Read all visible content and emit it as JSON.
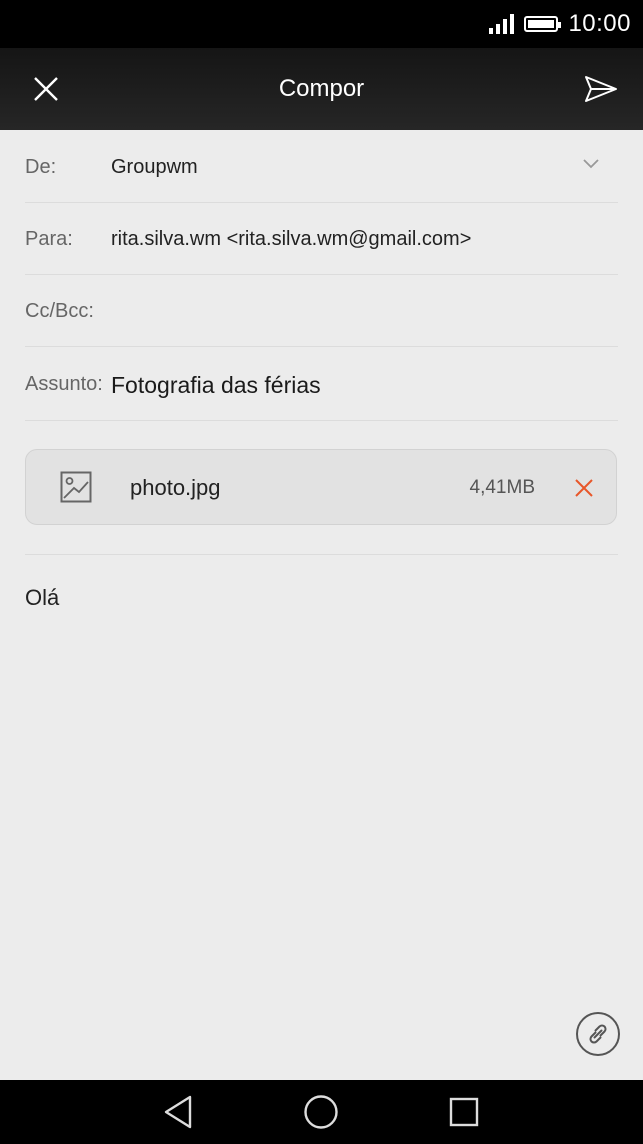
{
  "status_bar": {
    "time": "10:00",
    "signal_icon": "signal-icon",
    "battery_icon": "battery-icon"
  },
  "toolbar": {
    "title": "Compor",
    "close_icon": "close-icon",
    "send_icon": "send-icon"
  },
  "fields": {
    "from": {
      "label": "De:",
      "value": "Groupwm"
    },
    "to": {
      "label": "Para:",
      "value": "rita.silva.wm <rita.silva.wm@gmail.com>"
    },
    "cc_bcc": {
      "label": "Cc/Bcc:",
      "value": ""
    },
    "subject": {
      "label": "Assunto:",
      "value": "Fotografia das férias"
    }
  },
  "attachment": {
    "name": "photo.jpg",
    "size": "4,41MB",
    "remove_color": "#e8572a"
  },
  "body": {
    "text": "Olá"
  },
  "nav": {
    "back_icon": "back-icon",
    "home_icon": "home-icon",
    "recents_icon": "recents-icon"
  }
}
